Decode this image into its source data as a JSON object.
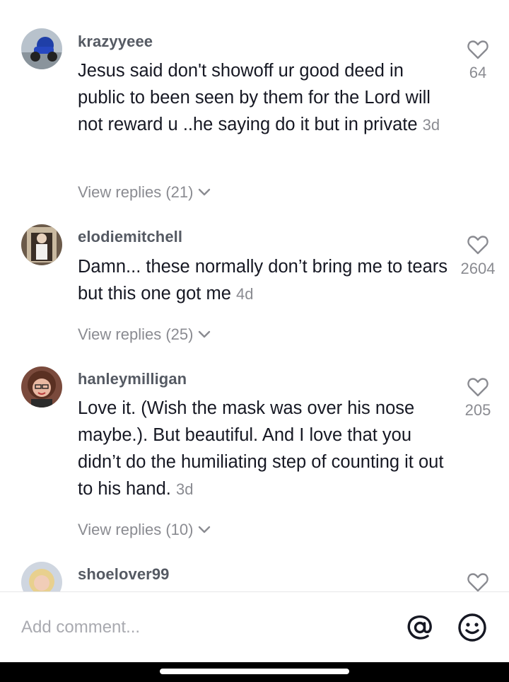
{
  "comments": [
    {
      "username": "krazyyeee",
      "text": "Jesus said don't showoff ur good deed in public to been seen by them for the Lord will not reward u ..he saying do it but in private",
      "time": "3d",
      "likes": "64",
      "replies_label": "View replies (21)"
    },
    {
      "username": "elodiemitchell",
      "text": "Damn... these normally don’t bring me to tears but this one got me",
      "time": "4d",
      "likes": "2604",
      "replies_label": "View replies (25)"
    },
    {
      "username": "hanleymilligan",
      "text": "Love it. (Wish the mask was over his nose maybe.). But beautiful. And I love that you didn’t do the humiliating step of counting it out to his hand.",
      "time": "3d",
      "likes": "205",
      "replies_label": "View replies (10)"
    },
    {
      "username": "shoelover99"
    }
  ],
  "composer": {
    "placeholder": "Add comment..."
  },
  "icons": {
    "like": "heart-outline-icon",
    "replies": "chevron-down-icon",
    "mention": "at-sign-icon",
    "emoji": "smiley-face-icon"
  },
  "colors": {
    "text": "#161823",
    "username": "#555a63",
    "muted": "#8a8b91",
    "placeholder": "#a9aab0"
  }
}
